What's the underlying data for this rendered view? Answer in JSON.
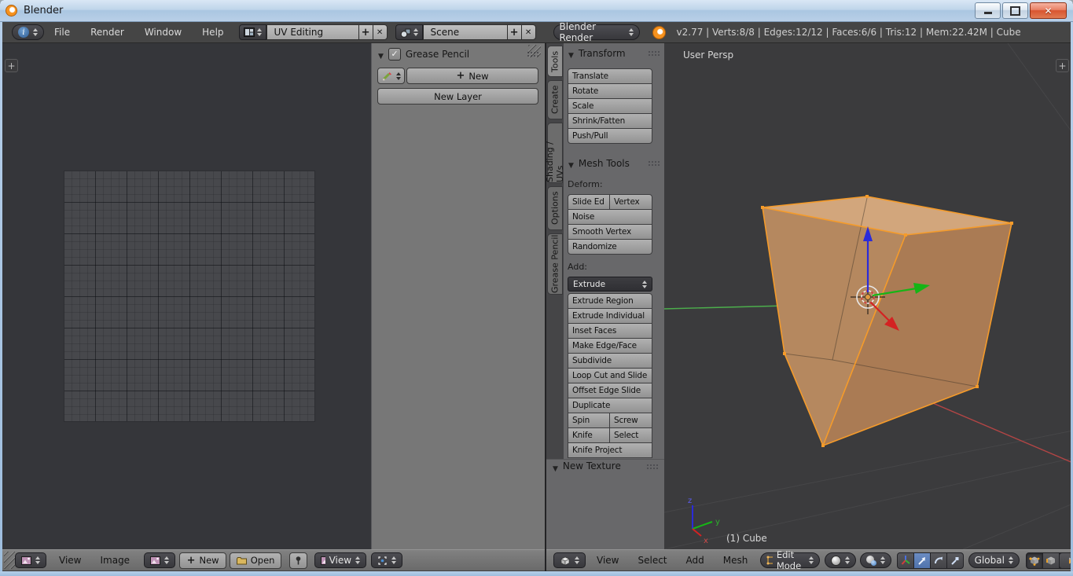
{
  "window": {
    "title": "Blender"
  },
  "topbar": {
    "menus": [
      "File",
      "Render",
      "Window",
      "Help"
    ],
    "layout_value": "UV Editing",
    "scene_value": "Scene",
    "engine_value": "Blender Render",
    "stats": "v2.77 | Verts:8/8 | Edges:12/12 | Faces:6/6 | Tris:12 | Mem:22.42M | Cube"
  },
  "uv_editor": {
    "grease_pencil": {
      "title": "Grease Pencil",
      "new_button": "New",
      "new_layer_button": "New Layer"
    },
    "header": {
      "menus": [
        "View",
        "Image"
      ],
      "new_button": "New",
      "open_button": "Open",
      "view_dropdown": "View"
    }
  },
  "tool_shelf": {
    "tabs": [
      "Tools",
      "Create",
      "Shading / UVs",
      "Options",
      "Grease Pencil"
    ],
    "active_tab": "Tools",
    "transform": {
      "title": "Transform",
      "buttons": [
        "Translate",
        "Rotate",
        "Scale",
        "Shrink/Fatten",
        "Push/Pull"
      ]
    },
    "mesh_tools": {
      "title": "Mesh Tools",
      "deform_label": "Deform:",
      "deform_pair": [
        "Slide Ed",
        "Vertex"
      ],
      "deform_buttons": [
        "Noise",
        "Smooth Vertex",
        "Randomize"
      ],
      "add_label": "Add:",
      "extrude_dropdown": "Extrude",
      "add_buttons": [
        "Extrude Region",
        "Extrude Individual",
        "Inset Faces",
        "Make Edge/Face",
        "Subdivide",
        "Loop Cut and Slide",
        "Offset Edge Slide",
        "Duplicate"
      ],
      "spin_row": [
        "Spin",
        "Screw"
      ],
      "knife_row": [
        "Knife",
        "Select"
      ],
      "clipped_button": "Knife Project"
    },
    "new_texture_title": "New Texture"
  },
  "viewport": {
    "view_label": "User Persp",
    "object_label": "(1) Cube",
    "axis_x": "x",
    "axis_y": "y",
    "axis_z": "z",
    "header": {
      "menus": [
        "View",
        "Select",
        "Add",
        "Mesh"
      ],
      "mode_dropdown": "Edit Mode",
      "orientation_dropdown": "Global"
    }
  },
  "colors": {
    "cube_top": "#d2a67c",
    "cube_left": "#b5885f",
    "cube_right": "#aa7b54",
    "cube_edge": "#f59b2a",
    "axis_green": "#4cae4c",
    "axis_red": "#b34545",
    "arrow_blue": "#2b2bd9",
    "arrow_green": "#16b516",
    "arrow_red": "#d42222",
    "select_blue": "#5d82c2"
  }
}
